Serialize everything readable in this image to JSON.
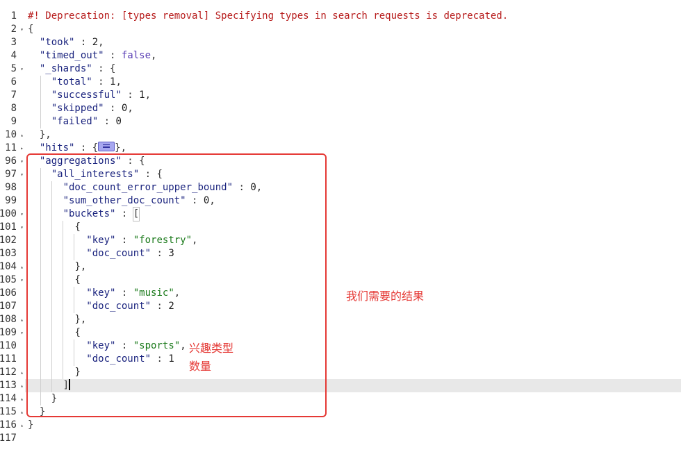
{
  "editor": {
    "warning": "#! Deprecation: [types removal] Specifying types in search requests is deprecated.",
    "active_line": 113,
    "lines": [
      {
        "num": "1",
        "fold": ""
      },
      {
        "num": "2",
        "fold": "down"
      },
      {
        "num": "3",
        "fold": ""
      },
      {
        "num": "4",
        "fold": ""
      },
      {
        "num": "5",
        "fold": "down"
      },
      {
        "num": "6",
        "fold": ""
      },
      {
        "num": "7",
        "fold": ""
      },
      {
        "num": "8",
        "fold": ""
      },
      {
        "num": "9",
        "fold": ""
      },
      {
        "num": "10",
        "fold": "up"
      },
      {
        "num": "11",
        "fold": "right"
      },
      {
        "num": "96",
        "fold": "down"
      },
      {
        "num": "97",
        "fold": "down"
      },
      {
        "num": "98",
        "fold": ""
      },
      {
        "num": "99",
        "fold": ""
      },
      {
        "num": "100",
        "fold": "down"
      },
      {
        "num": "101",
        "fold": "down"
      },
      {
        "num": "102",
        "fold": ""
      },
      {
        "num": "103",
        "fold": ""
      },
      {
        "num": "104",
        "fold": "up"
      },
      {
        "num": "105",
        "fold": "down"
      },
      {
        "num": "106",
        "fold": ""
      },
      {
        "num": "107",
        "fold": ""
      },
      {
        "num": "108",
        "fold": "up"
      },
      {
        "num": "109",
        "fold": "down"
      },
      {
        "num": "110",
        "fold": ""
      },
      {
        "num": "111",
        "fold": ""
      },
      {
        "num": "112",
        "fold": "up"
      },
      {
        "num": "113",
        "fold": "up"
      },
      {
        "num": "114",
        "fold": "up"
      },
      {
        "num": "115",
        "fold": "up"
      },
      {
        "num": "116",
        "fold": "up"
      },
      {
        "num": "117",
        "fold": ""
      }
    ],
    "tokens": {
      "brace_open": "{",
      "brace_close": "}",
      "brace_close_comma": "},",
      "bracket_open": "[",
      "bracket_close": "]",
      "sep": " : ",
      "comma": ",",
      "took_key": "\"took\"",
      "took_val": "2",
      "timed_out_key": "\"timed_out\"",
      "timed_out_val": "false",
      "shards_key": "\"_shards\"",
      "total_key": "\"total\"",
      "total_val": "1",
      "successful_key": "\"successful\"",
      "successful_val": "1",
      "skipped_key": "\"skipped\"",
      "skipped_val": "0",
      "failed_key": "\"failed\"",
      "failed_val": "0",
      "hits_key": "\"hits\"",
      "hits_tail": "},",
      "aggregations_key": "\"aggregations\"",
      "all_interests_key": "\"all_interests\"",
      "dceub_key": "\"doc_count_error_upper_bound\"",
      "dceub_val": "0",
      "sodc_key": "\"sum_other_doc_count\"",
      "sodc_val": "0",
      "buckets_key": "\"buckets\"",
      "key_key": "\"key\"",
      "doc_count_key": "\"doc_count\"",
      "bucket1_key": "\"forestry\"",
      "bucket1_count": "3",
      "bucket2_key": "\"music\"",
      "bucket2_count": "2",
      "bucket3_key": "\"sports\"",
      "bucket3_count": "1"
    }
  },
  "annotations": {
    "result_note": "我们需要的结果",
    "type_note_line1": "兴趣类型",
    "type_note_line2": "数量",
    "color": "#e53935"
  }
}
